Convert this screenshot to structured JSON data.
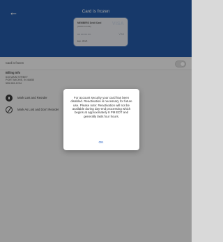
{
  "header": {
    "title": "Card is frozen",
    "back_icon": "arrow-left-icon"
  },
  "card": {
    "name": "MEMBERS Debit Card",
    "number_short": "(XXXX X XXX)",
    "brand": "VISA",
    "number_display": "•••• •••• •••• ••••",
    "brand_text": "Visa",
    "exp": "Exp. 05/25"
  },
  "frozen": {
    "label": "Card is frozen",
    "toggle_state": "off"
  },
  "billing": {
    "title": "Billing Info",
    "line1": "610 MAIN STREET",
    "line2": "PORT MICHIE, IN 46650",
    "phone": "555-555-1234"
  },
  "actions": {
    "mark_lost": "Mark Lost and Reorder",
    "mark_lost_no_reorder": "Mark As Lost and Don't Reorder"
  },
  "dialog": {
    "message": "For account security your card has been disabled. Reactivation is necessary for future use. Please note: Reactivation will not be available during day-end processing which begins at approximately 8 PM EDT and generally lasts four hours.",
    "ok_label": "OK"
  },
  "colors": {
    "header_bg": "#245aa6",
    "dialog_link": "#2a63c4",
    "overlay": "#00000058",
    "page_bg": "#f1f1f1"
  }
}
